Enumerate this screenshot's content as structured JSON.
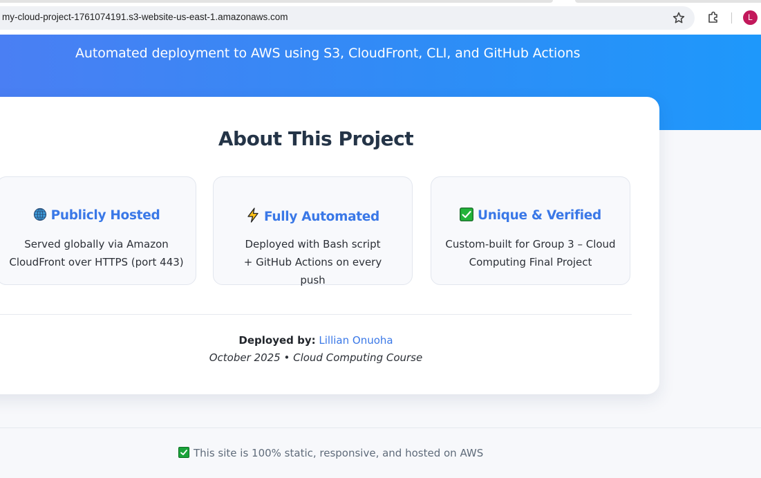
{
  "browser": {
    "url": "my-cloud-project-1761074191.s3-website-us-east-1.amazonaws.com",
    "profile_initial": "L",
    "profile_color": "#c2185b"
  },
  "hero": {
    "subtitle": "Automated deployment to AWS using S3, CloudFront, CLI, and GitHub Actions"
  },
  "about": {
    "title": "About This Project",
    "features": [
      {
        "icon": "globe-icon",
        "title": "Publicly Hosted",
        "description": "Served globally via Amazon CloudFront over HTTPS (port 443)"
      },
      {
        "icon": "lightning-icon",
        "title": "Fully Automated",
        "description": "Deployed with Bash script + GitHub Actions on every push"
      },
      {
        "icon": "checkmark-icon",
        "title": "Unique & Verified",
        "description": "Custom-built for Group 3 – Cloud Computing Final Project"
      }
    ],
    "deployed_label": "Deployed by:",
    "deployed_name": "Lillian Onuoha",
    "course_line": "October 2025 • Cloud Computing Course"
  },
  "footer": {
    "text": "This site is 100% static, responsive, and hosted on AWS"
  },
  "colors": {
    "accent": "#3a78e7",
    "hero_start": "#4a7ff3",
    "hero_end": "#1e98fb",
    "title": "#243447"
  }
}
